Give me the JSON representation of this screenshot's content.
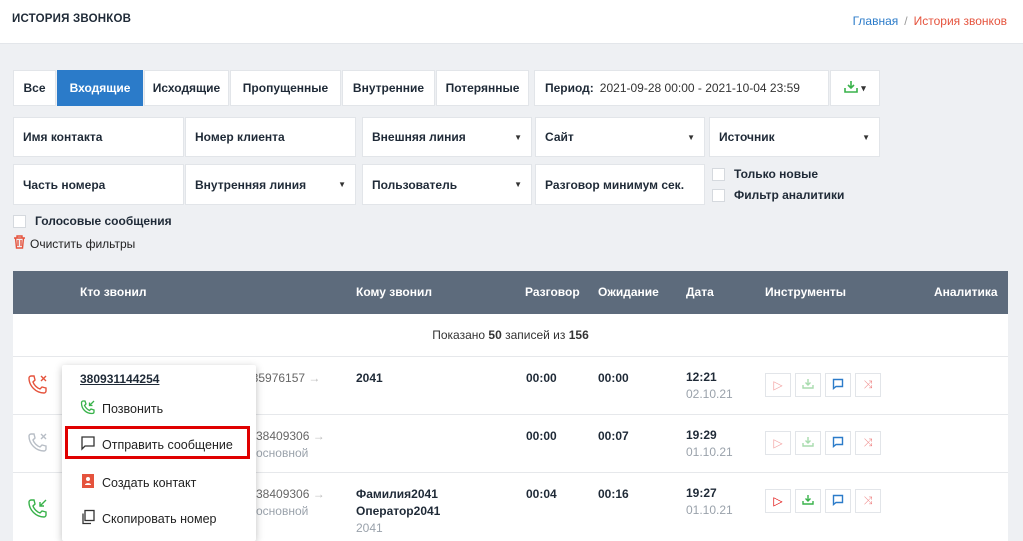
{
  "header": {
    "title": "ИСТОРИЯ ЗВОНКОВ",
    "breadcrumb_home": "Главная",
    "breadcrumb_sep": "/",
    "breadcrumb_current": "История звонков"
  },
  "tabs": [
    "Все",
    "Входящие",
    "Исходящие",
    "Пропущенные",
    "Внутренние",
    "Потерянные"
  ],
  "active_tab": "Входящие",
  "period": {
    "label": "Период:",
    "value": "2021-09-28 00:00 - 2021-10-04 23:59"
  },
  "download": {
    "icon": "download-icon",
    "caret": "▾"
  },
  "filters": {
    "contact_name": "Имя контакта",
    "client_number": "Номер клиента",
    "external_line": "Внешняя линия",
    "site": "Сайт",
    "source": "Источник",
    "number_part": "Часть номера",
    "internal_line": "Внутренняя линия",
    "user": "Пользователь",
    "min_talk": "Разговор минимум сек.",
    "only_new": "Только новые",
    "analytics_filter": "Фильтр аналитики",
    "voice_messages": "Голосовые сообщения",
    "clear": "Очистить фильтры"
  },
  "table": {
    "columns": [
      "Кто звонил",
      "Кому звонил",
      "Разговор",
      "Ожидание",
      "Дата",
      "Инструменты",
      "Аналитика"
    ],
    "shown_prefix": "Показано",
    "shown_count": "50",
    "shown_mid": "записей из",
    "shown_total": "156",
    "rows": [
      {
        "from": "935976157",
        "arrow": "→",
        "to": "2041",
        "to2": "",
        "to_sub": "",
        "talk": "00:00",
        "wait": "00:00",
        "time": "12:21",
        "date": "02.10.21",
        "from_sub": "",
        "status": "missed"
      },
      {
        "from": "38409306",
        "arrow": "→",
        "to": "",
        "to2": "",
        "to_sub": "",
        "talk": "00:00",
        "wait": "00:07",
        "time": "19:29",
        "date": "01.10.21",
        "from_sub": "основной",
        "status": "missed-grey"
      },
      {
        "from": "38409306",
        "arrow": "→",
        "to": "Фамилия2041",
        "to2": "Оператор2041",
        "to_sub": "2041",
        "talk": "00:04",
        "wait": "00:16",
        "time": "19:27",
        "date": "01.10.21",
        "from_sub": "основной",
        "status": "answered"
      }
    ]
  },
  "popup": {
    "phone": "380931144254",
    "call": "Позвонить",
    "send_message": "Отправить сообщение",
    "create_contact": "Создать контакт",
    "copy_number": "Скопировать номер"
  },
  "colors": {
    "accent": "#2b7bc9",
    "header_bg": "#5d6b7c",
    "danger": "#e5533d",
    "success": "#38b24a",
    "highlight": "#e00000"
  }
}
